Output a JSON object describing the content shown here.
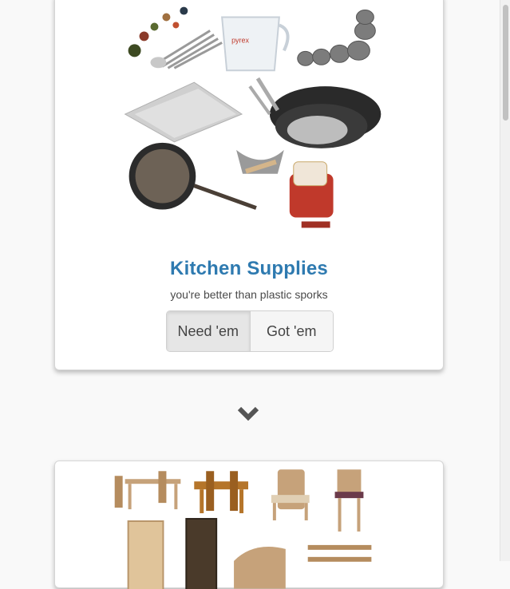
{
  "cards": [
    {
      "title": "Kitchen Supplies",
      "subtitle": "you're better than plastic sporks",
      "buttons": [
        "Need 'em",
        "Got 'em"
      ],
      "image_alt": "kitchen-supplies-collage",
      "image_text": "pyrex"
    },
    {
      "image_alt": "furniture-collage"
    }
  ],
  "icons": {
    "next": "chevron-down-icon"
  },
  "colors": {
    "title": "#2e7ab0",
    "page_background": "#f9f9f9",
    "active_button": "#e6e6e6"
  }
}
